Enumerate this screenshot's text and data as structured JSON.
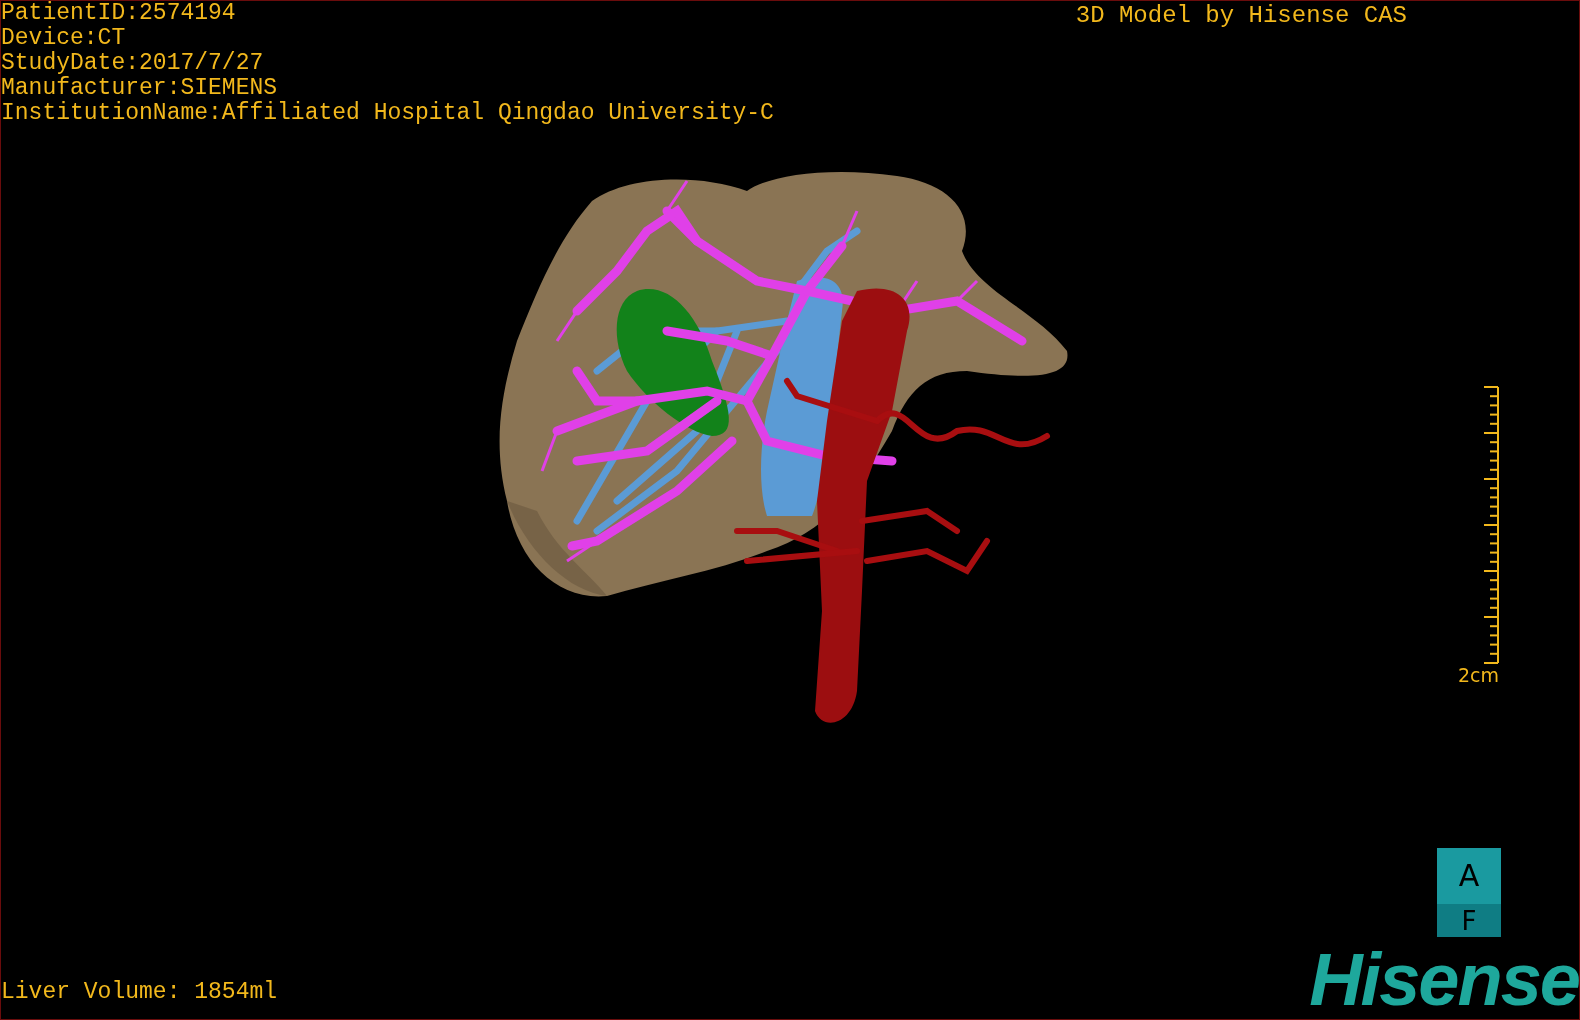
{
  "patient_info": [
    "PatientID:2574194",
    "Device:CT",
    "StudyDate:2017/7/27",
    "Manufacturer:SIEMENS",
    "InstitutionName:Affiliated Hospital Qingdao University-C"
  ],
  "title": "3D Model by Hisense CAS",
  "scale_bar": {
    "label": "2cm"
  },
  "orientation_cube": {
    "top": "A",
    "bottom": "F"
  },
  "liver_volume": "Liver Volume: 1854ml",
  "logo": "Hisense"
}
